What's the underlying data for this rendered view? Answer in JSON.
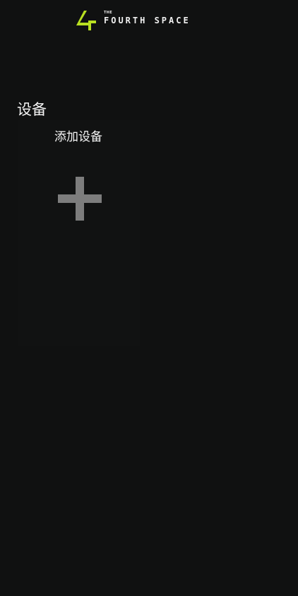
{
  "header": {
    "logo_small": "THE",
    "logo_text": "FOURTH SPACE",
    "logo_color": "#b9e021"
  },
  "devices": {
    "title": "设备",
    "add_device_label": "添加设备",
    "add_icon": "plus-icon",
    "add_icon_color": "#7d7d7d"
  }
}
